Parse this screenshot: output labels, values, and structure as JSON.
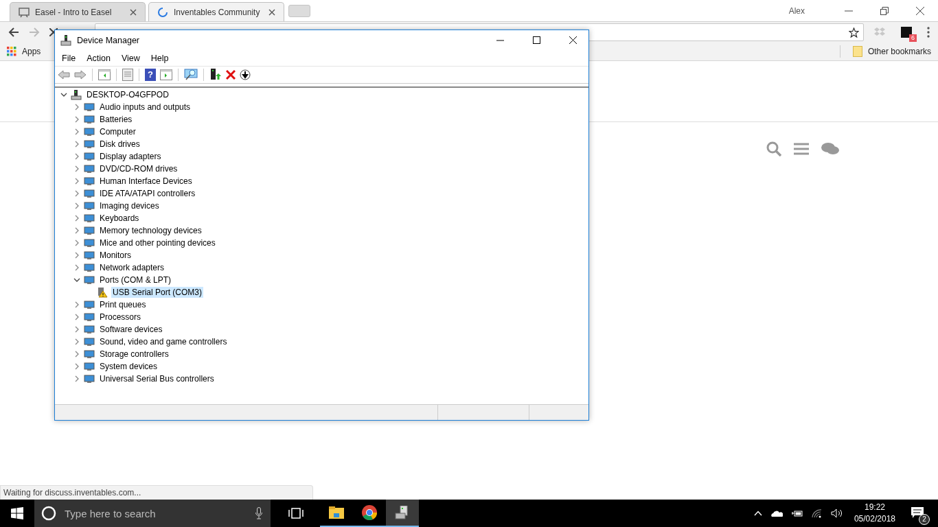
{
  "browser": {
    "tabs": [
      {
        "title": "Easel - Intro to Easel",
        "selected": false
      },
      {
        "title": "Inventables Community",
        "selected": true
      }
    ],
    "profile": "Alex",
    "extension_badge": "6",
    "bookmarks": [
      "Apps"
    ],
    "other_bookmarks": "Other bookmarks",
    "status_bubble": "Waiting for discuss.inventables.com..."
  },
  "device_manager": {
    "title": "Device Manager",
    "menu": [
      "File",
      "Action",
      "View",
      "Help"
    ],
    "help_button": "?",
    "tree": [
      {
        "label": "DESKTOP-O4GFPOD",
        "expanded": true,
        "selected": false,
        "children": [
          {
            "label": "Audio inputs and outputs",
            "expanded": false,
            "selected": false
          },
          {
            "label": "Batteries",
            "expanded": false,
            "selected": false
          },
          {
            "label": "Computer",
            "expanded": false,
            "selected": false
          },
          {
            "label": "Disk drives",
            "expanded": false,
            "selected": false
          },
          {
            "label": "Display adapters",
            "expanded": false,
            "selected": false
          },
          {
            "label": "DVD/CD-ROM drives",
            "expanded": false,
            "selected": false
          },
          {
            "label": "Human Interface Devices",
            "expanded": false,
            "selected": false
          },
          {
            "label": "IDE ATA/ATAPI controllers",
            "expanded": false,
            "selected": false
          },
          {
            "label": "Imaging devices",
            "expanded": false,
            "selected": false
          },
          {
            "label": "Keyboards",
            "expanded": false,
            "selected": false
          },
          {
            "label": "Memory technology devices",
            "expanded": false,
            "selected": false
          },
          {
            "label": "Mice and other pointing devices",
            "expanded": false,
            "selected": false
          },
          {
            "label": "Monitors",
            "expanded": false,
            "selected": false
          },
          {
            "label": "Network adapters",
            "expanded": false,
            "selected": false
          },
          {
            "label": "Ports (COM & LPT)",
            "expanded": true,
            "selected": false,
            "children": [
              {
                "label": "USB Serial Port (COM3)",
                "selected": true,
                "warning": true
              }
            ]
          },
          {
            "label": "Print queues",
            "expanded": false,
            "selected": false
          },
          {
            "label": "Processors",
            "expanded": false,
            "selected": false
          },
          {
            "label": "Software devices",
            "expanded": false,
            "selected": false
          },
          {
            "label": "Sound, video and game controllers",
            "expanded": false,
            "selected": false
          },
          {
            "label": "Storage controllers",
            "expanded": false,
            "selected": false
          },
          {
            "label": "System devices",
            "expanded": false,
            "selected": false
          },
          {
            "label": "Universal Serial Bus controllers",
            "expanded": false,
            "selected": false
          }
        ]
      }
    ]
  },
  "taskbar": {
    "search_placeholder": "Type here to search",
    "time": "19:22",
    "date": "05/02/2018",
    "notification_count": "2"
  }
}
